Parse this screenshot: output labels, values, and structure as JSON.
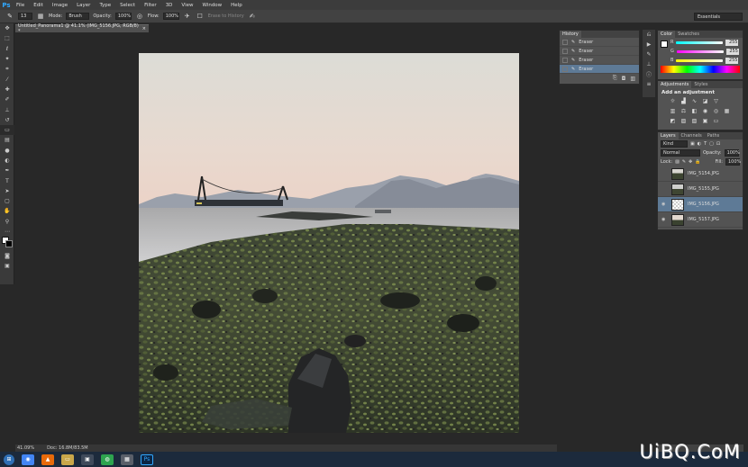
{
  "menubar": {
    "logo": "Ps",
    "items": [
      "File",
      "Edit",
      "Image",
      "Layer",
      "Type",
      "Select",
      "Filter",
      "3D",
      "View",
      "Window",
      "Help"
    ]
  },
  "options": {
    "brush_size": "13",
    "mode_label": "Mode:",
    "mode_value": "Brush",
    "opacity_label": "Opacity:",
    "opacity_value": "100%",
    "flow_label": "Flow:",
    "flow_value": "100%",
    "erase_history": "Erase to History",
    "workspace": "Essentials"
  },
  "document": {
    "tab_title": "Untitled_Panorama1 @ 41.1% (IMG_5156.JPG, RGB/8) *",
    "close": "×"
  },
  "status": {
    "zoom": "41.09%",
    "doc_size": "Doc: 16.8M/83.5M"
  },
  "history": {
    "tab": "History",
    "items": [
      "Eraser",
      "Eraser",
      "Eraser",
      "Eraser"
    ],
    "selected_index": 3
  },
  "color": {
    "tabs": [
      "Color",
      "Swatches"
    ],
    "channels": [
      {
        "label": "R",
        "value": "255"
      },
      {
        "label": "G",
        "value": "255"
      },
      {
        "label": "B",
        "value": "255"
      }
    ]
  },
  "adjustments": {
    "tabs": [
      "Adjustments",
      "Styles"
    ],
    "title": "Add an adjustment"
  },
  "layers": {
    "tabs": [
      "Layers",
      "Channels",
      "Paths"
    ],
    "kind": "Kind",
    "blend_mode": "Normal",
    "opacity_label": "Opacity:",
    "opacity_value": "100%",
    "lock_label": "Lock:",
    "fill_label": "Fill:",
    "fill_value": "100%",
    "items": [
      {
        "name": "IMG_5154.JPG",
        "visible": false
      },
      {
        "name": "IMG_5155.JPG",
        "visible": false
      },
      {
        "name": "IMG_5156.JPG",
        "visible": true
      },
      {
        "name": "IMG_5157.JPG",
        "visible": true
      }
    ],
    "selected_index": 2
  },
  "watermark": "UiBQ.CoM",
  "colors": {
    "accent_selection": "#5e7a96",
    "panel_bg": "#535353",
    "app_bg": "#282828"
  }
}
